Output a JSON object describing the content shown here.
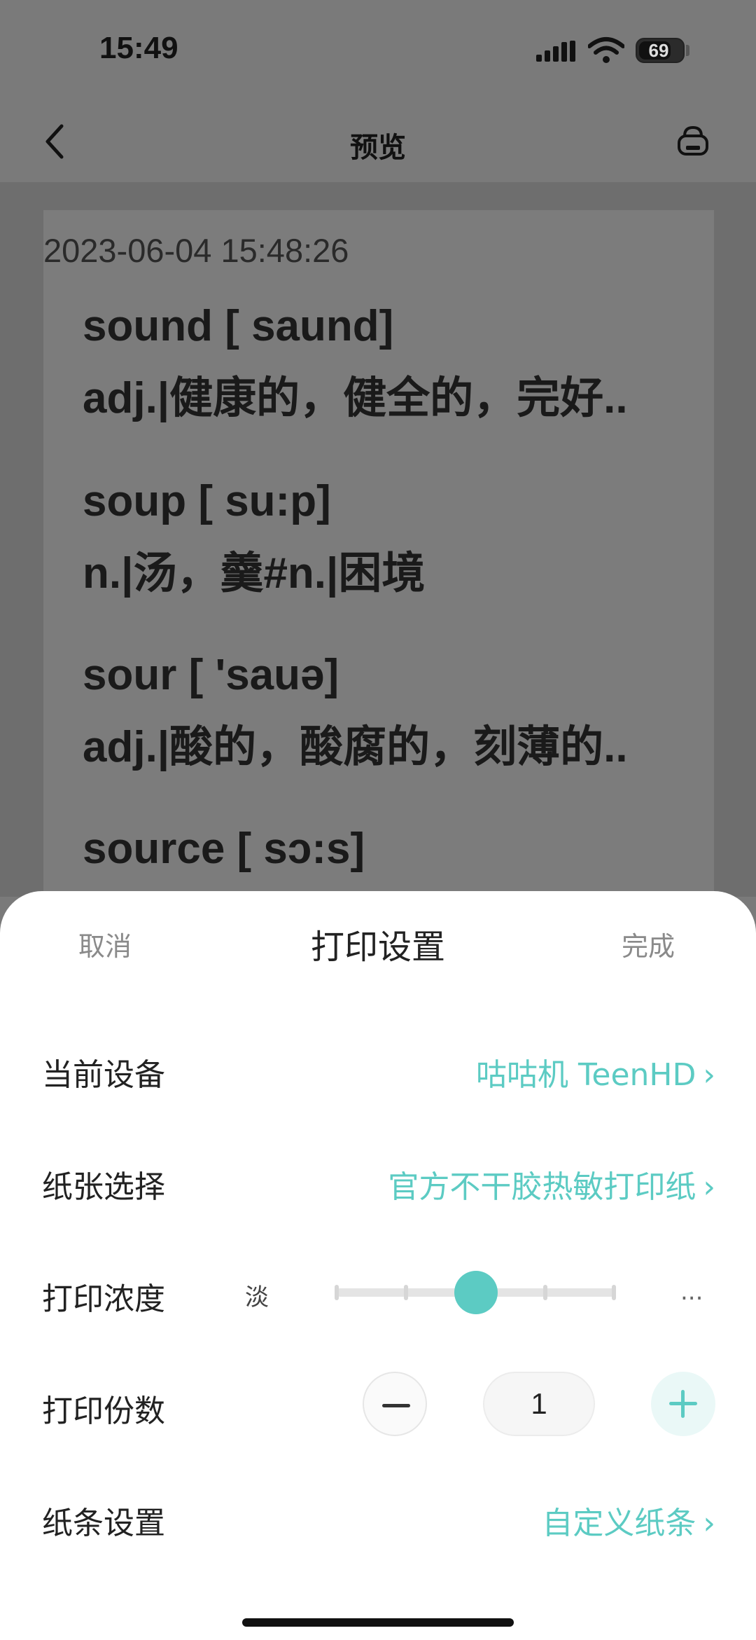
{
  "status_bar": {
    "time": "15:49",
    "battery": "69"
  },
  "nav": {
    "title": "预览",
    "back_icon": "chevron-left-icon",
    "action_icon": "printer-icon"
  },
  "preview": {
    "timestamp": "2023-06-04 15:48:26",
    "entries": [
      {
        "word": "sound  [ saund]",
        "definition": "adj.|健康的，健全的，完好.."
      },
      {
        "word": "soup  [ su:p]",
        "definition": "n.|汤，羹#n.|困境"
      },
      {
        "word": "sour  [ 'sauə]",
        "definition": "adj.|酸的，酸腐的，刻薄的.."
      },
      {
        "word": "source  [ sɔ:s]",
        "definition": ""
      }
    ]
  },
  "sheet": {
    "cancel": "取消",
    "title": "打印设置",
    "done": "完成",
    "rows": {
      "device": {
        "label": "当前设备",
        "value": "咕咕机 TeenHD"
      },
      "paper": {
        "label": "纸张选择",
        "value": "官方不干胶热敏打印纸"
      },
      "density": {
        "label": "打印浓度",
        "min_label": "淡",
        "max_label": "...",
        "level": 0.5,
        "steps": 5
      },
      "copies": {
        "label": "打印份数",
        "value": "1"
      },
      "strip": {
        "label": "纸条设置",
        "value": "自定义纸条"
      }
    }
  },
  "colors": {
    "accent": "#5ccbc3",
    "overlay": "#7a7a7a"
  }
}
